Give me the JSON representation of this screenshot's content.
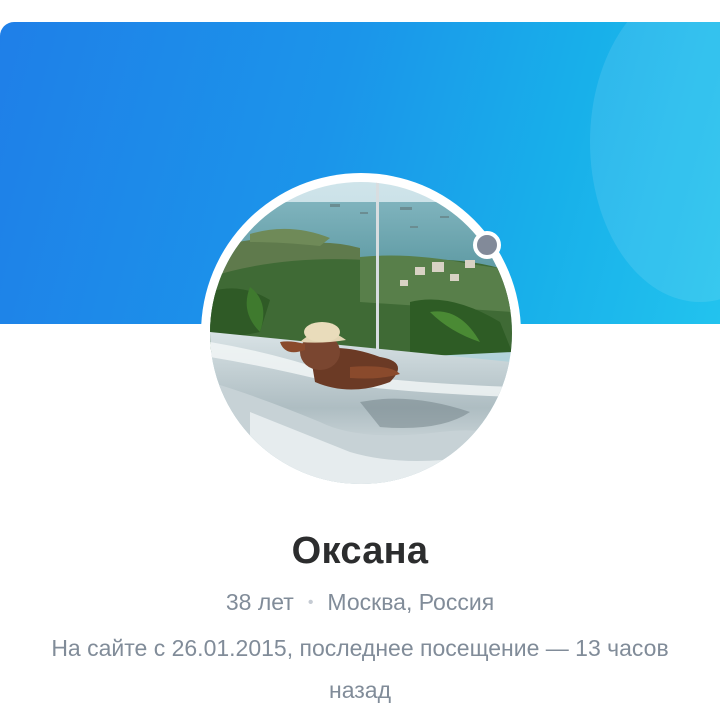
{
  "profile": {
    "name": "Оксана",
    "age": "38 лет",
    "separator": "•",
    "location": "Москва, Россия",
    "visit_info": "На сайте с 26.01.2015, последнее посещение — 13 часов назад",
    "online_status_color": "#828a99"
  },
  "colors": {
    "cover_start": "#1f7fe8",
    "cover_end": "#22c3ee",
    "name_text": "#2c2d2e",
    "secondary_text": "#818c99"
  },
  "icons": {
    "status": "offline-status-dot"
  }
}
